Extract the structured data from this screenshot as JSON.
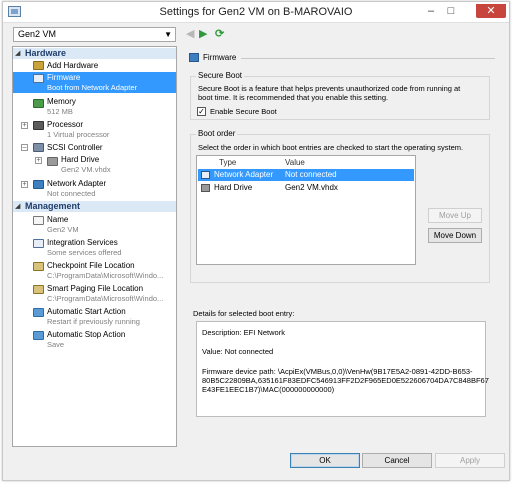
{
  "window": {
    "title": "Settings for Gen2 VM on B-MAROVAIO",
    "minimize": "–",
    "maximize": "□",
    "close": "✕"
  },
  "toolbar": {
    "vm_selected": "Gen2 VM"
  },
  "sidebar": {
    "hardware_label": "Hardware",
    "management_label": "Management",
    "hardware": [
      {
        "name": "Add Hardware",
        "sub": ""
      },
      {
        "name": "Firmware",
        "sub": "Boot from Network Adapter"
      },
      {
        "name": "Memory",
        "sub": "512 MB"
      },
      {
        "name": "Processor",
        "sub": "1 Virtual processor"
      },
      {
        "name": "SCSI Controller",
        "sub": ""
      },
      {
        "name": "Hard Drive",
        "sub": "Gen2 VM.vhdx"
      },
      {
        "name": "Network Adapter",
        "sub": "Not connected"
      }
    ],
    "management": [
      {
        "name": "Name",
        "sub": "Gen2 VM"
      },
      {
        "name": "Integration Services",
        "sub": "Some services offered"
      },
      {
        "name": "Checkpoint File Location",
        "sub": "C:\\ProgramData\\Microsoft\\Windo..."
      },
      {
        "name": "Smart Paging File Location",
        "sub": "C:\\ProgramData\\Microsoft\\Windo..."
      },
      {
        "name": "Automatic Start Action",
        "sub": "Restart if previously running"
      },
      {
        "name": "Automatic Stop Action",
        "sub": "Save"
      }
    ]
  },
  "panel": {
    "header": "Firmware",
    "secure_boot": {
      "title": "Secure Boot",
      "desc1": "Secure Boot is a feature that helps prevents unauthorized code from running at",
      "desc2": "boot time. It is recommended that you enable this setting.",
      "checkbox_label": "Enable Secure Boot",
      "checked": true
    },
    "boot_order": {
      "title": "Boot order",
      "desc": "Select the order in which boot entries are checked to start the operating system.",
      "col_type": "Type",
      "col_value": "Value",
      "rows": [
        {
          "type": "Network Adapter",
          "value": "Not connected"
        },
        {
          "type": "Hard Drive",
          "value": "Gen2 VM.vhdx"
        }
      ],
      "move_up": "Move Up",
      "move_down": "Move Down"
    },
    "details": {
      "label": "Details for selected boot entry:",
      "description": "Description: EFI Network",
      "value": "Value: Not connected",
      "path1": "Firmware device path: \\AcpiEx(VMBus,0,0)\\VenHw(9B17E5A2-0891-42DD-B653-",
      "path2": "80B5C22809BA,635161F83EDFC546913FF2D2F965ED0E522606704DA7C848BF67",
      "path3": "E43FE1EEC1B7)\\MAC(000000000000)"
    }
  },
  "footer": {
    "ok": "OK",
    "cancel": "Cancel",
    "apply": "Apply"
  },
  "colors": {
    "selection": "#3399ff",
    "section_bg": "#dbe9f7"
  }
}
